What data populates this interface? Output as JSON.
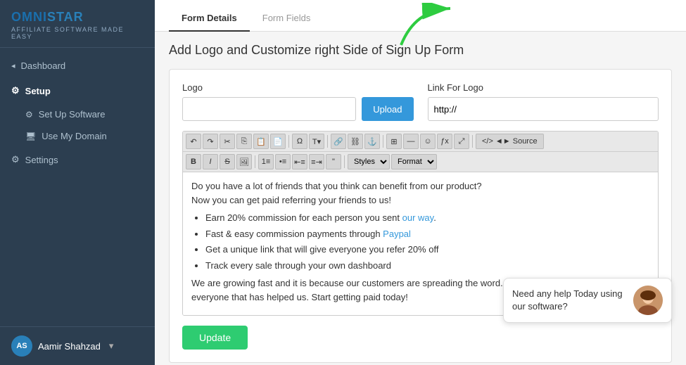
{
  "sidebar": {
    "logo": "OMNISTAR",
    "logo_highlight": "OMNI",
    "subtitle": "AFFILIATE SOFTWARE MADE EASY",
    "nav": {
      "dashboard_label": "Dashboard",
      "setup_label": "Setup",
      "set_up_software_label": "Set Up Software",
      "use_my_domain_label": "Use My Domain",
      "settings_label": "Settings"
    },
    "user": {
      "initials": "AS",
      "name": "Aamir Shahzad",
      "chevron": "▾"
    }
  },
  "tabs": [
    {
      "label": "Form Details",
      "active": true
    },
    {
      "label": "Form Fields",
      "active": false
    }
  ],
  "page_title": "Add Logo and Customize right Side of Sign Up Form",
  "logo_section": {
    "label": "Logo",
    "upload_btn_label": "Upload"
  },
  "link_section": {
    "label": "Link For Logo",
    "placeholder": "http://"
  },
  "toolbar_row1_buttons": [
    "◀",
    "▶",
    "🔄",
    "✂",
    "📋",
    "📝",
    "↶",
    "↷",
    "—",
    "◉",
    "T▾",
    "🔗",
    "⛓",
    "🖇",
    "≡",
    "≡",
    "♪",
    "ƒx",
    "⊞",
    "◄► Source"
  ],
  "editor_content": {
    "para1": "Do you have a lot of friends that you think can benefit from our product?",
    "para2": "Now you can get paid referring your friends to us!",
    "bullets": [
      "Earn 20% commission for each person you sent our way.",
      "Fast & easy commission payments through Paypal",
      "Get a unique link that will give everyone you refer 20% off",
      "Track every sale through your own dashboard"
    ],
    "para3": "We are growing fast and it is because our customers are spreading the word. Now we want to return the favor to everyone that has helped us. Start getting paid today!"
  },
  "update_btn_label": "Update",
  "help_bubble": {
    "text": "Need any help Today using our software?"
  },
  "styles_label": "Styles",
  "format_label": "Format"
}
